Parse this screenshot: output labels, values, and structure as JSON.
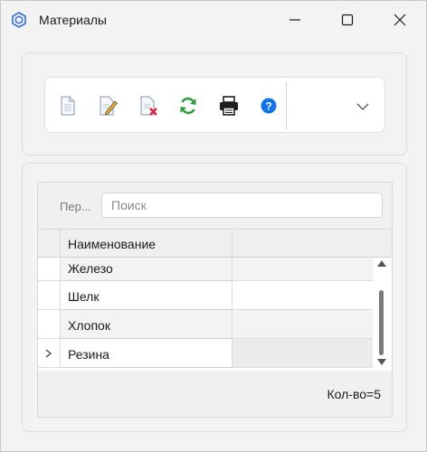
{
  "window": {
    "title": "Материалы",
    "icon": "hexagon-app-icon",
    "controls": [
      "minimize-icon",
      "maximize-icon",
      "close-icon"
    ]
  },
  "toolbar": {
    "buttons": [
      {
        "name": "new",
        "icon": "new-document-icon"
      },
      {
        "name": "edit",
        "icon": "edit-document-icon"
      },
      {
        "name": "delete",
        "icon": "delete-document-icon"
      },
      {
        "name": "refresh",
        "icon": "refresh-icon"
      },
      {
        "name": "print",
        "icon": "printer-icon"
      },
      {
        "name": "help",
        "icon": "help-icon"
      }
    ],
    "overflow_icon": "chevron-down-icon"
  },
  "search": {
    "label": "Пер...",
    "placeholder": "Поиск",
    "value": ""
  },
  "table": {
    "columns": [
      "Наименование",
      ""
    ],
    "rows": [
      {
        "name": "Железо",
        "current": false
      },
      {
        "name": "Шелк",
        "current": false
      },
      {
        "name": "Хлопок",
        "current": false
      },
      {
        "name": "Резина",
        "current": true
      }
    ]
  },
  "footer": {
    "count_text": "Кол-во=5"
  },
  "colors": {
    "help_blue": "#1473e6",
    "refresh_green": "#2e9e3e",
    "delete_red": "#d9243f"
  }
}
